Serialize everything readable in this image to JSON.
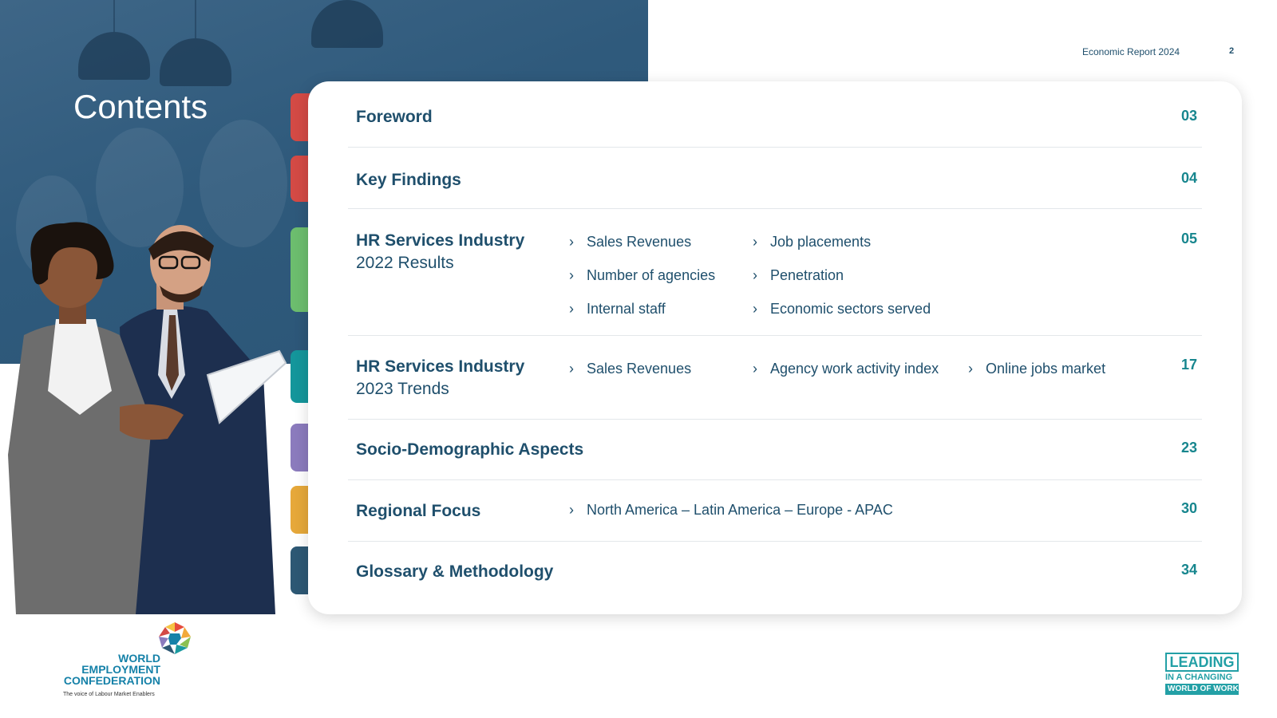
{
  "header": {
    "report_label": "Economic Report 2024",
    "page_number": "2"
  },
  "page_title": "Contents",
  "colors": {
    "primary": "#1f4f6c",
    "accent": "#17868e",
    "tab_colors": [
      "#d34a45",
      "#d34a45",
      "#6cbd6e",
      "#14969b",
      "#8b7bbd",
      "#e6a83a",
      "#2d5874"
    ]
  },
  "sections": [
    {
      "title": "Foreword",
      "subtitle": "",
      "page": "03",
      "bullets": []
    },
    {
      "title": "Key Findings",
      "subtitle": "",
      "page": "04",
      "bullets": []
    },
    {
      "title": "HR Services Industry",
      "subtitle": "2022 Results",
      "page": "05",
      "bullets": [
        "Sales Revenues",
        "Job placements",
        "Number of agencies",
        "Penetration",
        "Internal staff",
        "Economic sectors served"
      ]
    },
    {
      "title": "HR Services Industry",
      "subtitle": "2023 Trends",
      "page": "17",
      "bullets": [
        "Sales Revenues",
        "Agency work activity index",
        "Online jobs market"
      ]
    },
    {
      "title": "Socio-Demographic Aspects",
      "subtitle": "",
      "page": "23",
      "bullets": []
    },
    {
      "title": "Regional Focus",
      "subtitle": "",
      "page": "30",
      "bullets": [
        "North America – Latin America – Europe - APAC"
      ]
    },
    {
      "title": "Glossary & Methodology",
      "subtitle": "",
      "page": "34",
      "bullets": []
    }
  ],
  "logos": {
    "wec_line1": "WORLD",
    "wec_line2": "EMPLOYMENT",
    "wec_line3": "CONFEDERATION",
    "wec_tagline": "The voice of Labour Market Enablers",
    "leading_line1": "LEADING",
    "leading_line2": "IN A CHANGING",
    "leading_line3": "WORLD OF WORK"
  }
}
